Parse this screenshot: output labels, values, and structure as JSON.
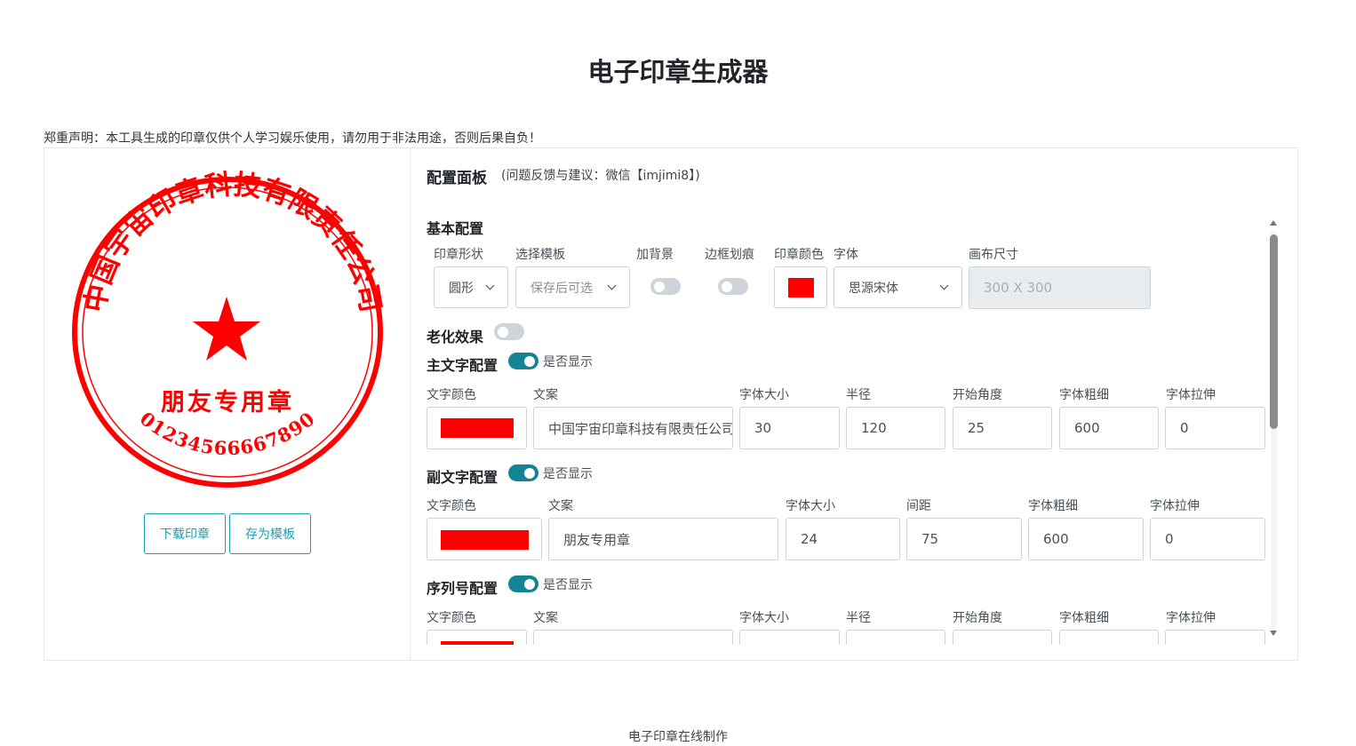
{
  "page": {
    "title": "电子印章生成器",
    "disclaimer": "郑重声明：本工具生成的印章仅供个人学习娱乐使用，请勿用于非法用途，否则后果自负！",
    "footer": "电子印章在线制作"
  },
  "stamp": {
    "color": "#ff0000",
    "main_text": "中国宇宙印章科技有限责任公司",
    "sub_text": "朋友专用章",
    "serial": "01234566667890",
    "star_icon": "star-icon"
  },
  "actions": {
    "download_label": "下载印章",
    "save_template_label": "存为模板"
  },
  "panel": {
    "title": "配置面板",
    "subtitle": "(问题反馈与建议：微信【imjimi8】)",
    "basic": {
      "title": "基本配置",
      "labels": {
        "shape": "印章形状",
        "template": "选择模板",
        "background": "加背景",
        "border_scratch": "边框划痕",
        "color": "印章颜色",
        "font": "字体",
        "canvas": "画布尺寸"
      },
      "shape_value": "圆形",
      "template_value": "保存后可选",
      "background_on": false,
      "border_scratch_on": false,
      "color_value": "#ff0000",
      "font_value": "思源宋体",
      "canvas_placeholder": "300 X 300"
    },
    "aging": {
      "label": "老化效果",
      "on": false
    },
    "main_text": {
      "title": "主文字配置",
      "show_label": "是否显示",
      "show_on": true,
      "labels": {
        "color": "文字颜色",
        "text": "文案",
        "size": "字体大小",
        "radius": "半径",
        "start_angle": "开始角度",
        "weight": "字体粗细",
        "stretch": "字体拉伸"
      },
      "color": "#ff0000",
      "text": "中国宇宙印章科技有限责任公司",
      "size": "30",
      "radius": "120",
      "start_angle": "25",
      "weight": "600",
      "stretch": "0"
    },
    "sub_text": {
      "title": "副文字配置",
      "show_label": "是否显示",
      "show_on": true,
      "labels": {
        "color": "文字颜色",
        "text": "文案",
        "size": "字体大小",
        "spacing": "间距",
        "weight": "字体粗细",
        "stretch": "字体拉伸"
      },
      "color": "#ff0000",
      "text": "朋友专用章",
      "size": "24",
      "spacing": "75",
      "weight": "600",
      "stretch": "0"
    },
    "serial": {
      "title": "序列号配置",
      "show_label": "是否显示",
      "show_on": true,
      "labels": {
        "color": "文字颜色",
        "text": "文案",
        "size": "字体大小",
        "radius": "半径",
        "start_angle": "开始角度",
        "weight": "字体粗细",
        "stretch": "字体拉伸"
      },
      "color": "#ff0000"
    }
  }
}
